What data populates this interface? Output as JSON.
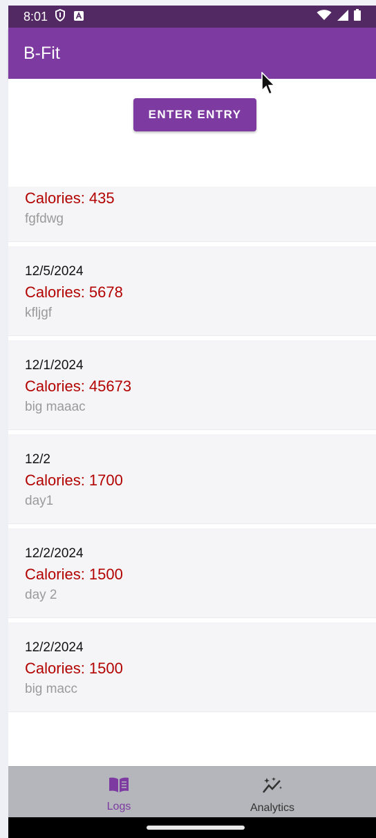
{
  "status_bar": {
    "time": "8:01",
    "icons": [
      "shield-icon",
      "a-notification-icon",
      "wifi-icon",
      "signal-icon",
      "battery-icon"
    ]
  },
  "app_bar": {
    "title": "B-Fit"
  },
  "colors": {
    "primary": "#7d3aa1",
    "status_bar": "#532963",
    "calories": "#b30000"
  },
  "main": {
    "enter_button_label": "ENTER ENTRY"
  },
  "logs": [
    {
      "date": "",
      "calories": "Calories: 435",
      "note": "fgfdwg"
    },
    {
      "date": "12/5/2024",
      "calories": "Calories: 5678",
      "note": "kfljgf"
    },
    {
      "date": "12/1/2024",
      "calories": "Calories: 45673",
      "note": "big maaac"
    },
    {
      "date": "12/2",
      "calories": "Calories: 1700",
      "note": "day1"
    },
    {
      "date": "12/2/2024",
      "calories": "Calories: 1500",
      "note": "day 2"
    },
    {
      "date": "12/2/2024",
      "calories": "Calories: 1500",
      "note": "big macc"
    }
  ],
  "bottom_nav": {
    "items": [
      {
        "label": "Logs",
        "icon": "book-icon",
        "selected": true
      },
      {
        "label": "Analytics",
        "icon": "analytics-icon",
        "selected": false
      }
    ]
  }
}
